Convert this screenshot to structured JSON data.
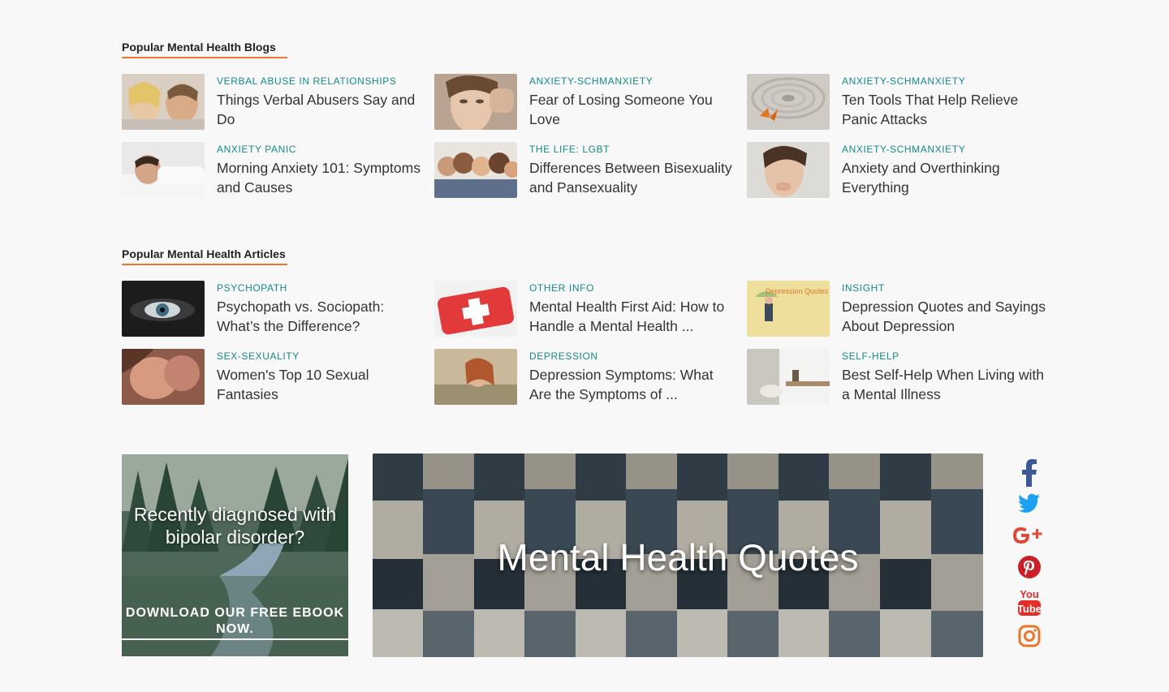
{
  "blogs": {
    "title": "Popular Mental Health Blogs",
    "items": [
      {
        "category": "VERBAL ABUSE IN RELATIONSHIPS",
        "title": "Things Verbal Abusers Say and Do"
      },
      {
        "category": "ANXIETY-SCHMANXIETY",
        "title": "Fear of Losing Someone You Love"
      },
      {
        "category": "ANXIETY-SCHMANXIETY",
        "title": "Ten Tools That Help Relieve Panic Attacks"
      },
      {
        "category": "ANXIETY PANIC",
        "title": "Morning Anxiety 101: Symptoms and Causes"
      },
      {
        "category": "THE LIFE: LGBT",
        "title": "Differences Between Bisexuality and Pansexuality"
      },
      {
        "category": "ANXIETY-SCHMANXIETY",
        "title": "Anxiety and Overthinking Everything"
      }
    ]
  },
  "articles": {
    "title": "Popular Mental Health Articles",
    "items": [
      {
        "category": "PSYCHOPATH",
        "title": "Psychopath vs. Sociopath: What’s the Difference?"
      },
      {
        "category": "OTHER INFO",
        "title": "Mental Health First Aid: How to Handle a Mental Health  ..."
      },
      {
        "category": "INSIGHT",
        "title": "Depression Quotes and Sayings About Depression"
      },
      {
        "category": "SEX-SEXUALITY",
        "title": "Women's Top 10 Sexual Fantasies"
      },
      {
        "category": "DEPRESSION",
        "title": "Depression Symptoms: What Are the Symptoms of ..."
      },
      {
        "category": "SELF-HELP",
        "title": "Best Self-Help When Living with a Mental Illness"
      }
    ]
  },
  "thumb_text": {
    "depression_quotes": "Depression Quotes"
  },
  "promo": {
    "heading": "Recently diagnosed with bipolar disorder?",
    "cta": "DOWNLOAD OUR FREE EBOOK NOW."
  },
  "quotes_banner": {
    "title": "Mental Health Quotes"
  },
  "social": [
    "facebook-icon",
    "twitter-icon",
    "google-plus-icon",
    "pinterest-icon",
    "youtube-icon",
    "instagram-icon"
  ],
  "colors": {
    "accent": "#e8772e",
    "category": "#138a88",
    "facebook": "#3b5998",
    "twitter": "#1da1f2",
    "google": "#dd4b39",
    "pinterest": "#cb2027",
    "youtube": "#e52d27",
    "instagram": "#e8772e"
  }
}
